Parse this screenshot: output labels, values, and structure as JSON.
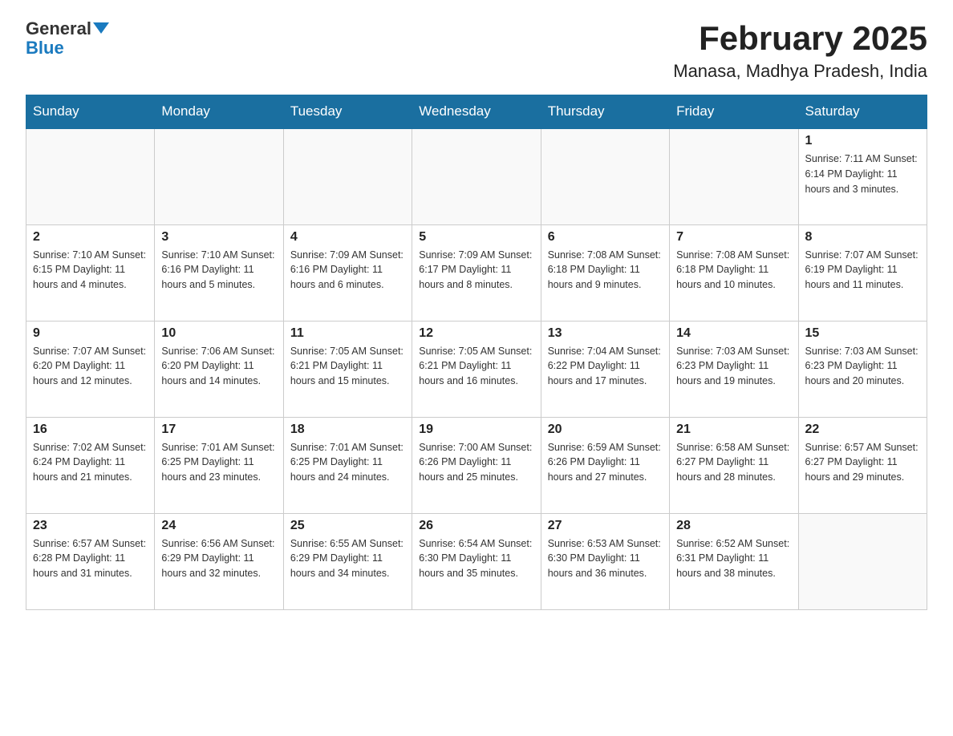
{
  "logo": {
    "general": "General",
    "blue": "Blue"
  },
  "title": "February 2025",
  "subtitle": "Manasa, Madhya Pradesh, India",
  "days_of_week": [
    "Sunday",
    "Monday",
    "Tuesday",
    "Wednesday",
    "Thursday",
    "Friday",
    "Saturday"
  ],
  "weeks": [
    [
      {
        "day": "",
        "info": ""
      },
      {
        "day": "",
        "info": ""
      },
      {
        "day": "",
        "info": ""
      },
      {
        "day": "",
        "info": ""
      },
      {
        "day": "",
        "info": ""
      },
      {
        "day": "",
        "info": ""
      },
      {
        "day": "1",
        "info": "Sunrise: 7:11 AM\nSunset: 6:14 PM\nDaylight: 11 hours and 3 minutes."
      }
    ],
    [
      {
        "day": "2",
        "info": "Sunrise: 7:10 AM\nSunset: 6:15 PM\nDaylight: 11 hours and 4 minutes."
      },
      {
        "day": "3",
        "info": "Sunrise: 7:10 AM\nSunset: 6:16 PM\nDaylight: 11 hours and 5 minutes."
      },
      {
        "day": "4",
        "info": "Sunrise: 7:09 AM\nSunset: 6:16 PM\nDaylight: 11 hours and 6 minutes."
      },
      {
        "day": "5",
        "info": "Sunrise: 7:09 AM\nSunset: 6:17 PM\nDaylight: 11 hours and 8 minutes."
      },
      {
        "day": "6",
        "info": "Sunrise: 7:08 AM\nSunset: 6:18 PM\nDaylight: 11 hours and 9 minutes."
      },
      {
        "day": "7",
        "info": "Sunrise: 7:08 AM\nSunset: 6:18 PM\nDaylight: 11 hours and 10 minutes."
      },
      {
        "day": "8",
        "info": "Sunrise: 7:07 AM\nSunset: 6:19 PM\nDaylight: 11 hours and 11 minutes."
      }
    ],
    [
      {
        "day": "9",
        "info": "Sunrise: 7:07 AM\nSunset: 6:20 PM\nDaylight: 11 hours and 12 minutes."
      },
      {
        "day": "10",
        "info": "Sunrise: 7:06 AM\nSunset: 6:20 PM\nDaylight: 11 hours and 14 minutes."
      },
      {
        "day": "11",
        "info": "Sunrise: 7:05 AM\nSunset: 6:21 PM\nDaylight: 11 hours and 15 minutes."
      },
      {
        "day": "12",
        "info": "Sunrise: 7:05 AM\nSunset: 6:21 PM\nDaylight: 11 hours and 16 minutes."
      },
      {
        "day": "13",
        "info": "Sunrise: 7:04 AM\nSunset: 6:22 PM\nDaylight: 11 hours and 17 minutes."
      },
      {
        "day": "14",
        "info": "Sunrise: 7:03 AM\nSunset: 6:23 PM\nDaylight: 11 hours and 19 minutes."
      },
      {
        "day": "15",
        "info": "Sunrise: 7:03 AM\nSunset: 6:23 PM\nDaylight: 11 hours and 20 minutes."
      }
    ],
    [
      {
        "day": "16",
        "info": "Sunrise: 7:02 AM\nSunset: 6:24 PM\nDaylight: 11 hours and 21 minutes."
      },
      {
        "day": "17",
        "info": "Sunrise: 7:01 AM\nSunset: 6:25 PM\nDaylight: 11 hours and 23 minutes."
      },
      {
        "day": "18",
        "info": "Sunrise: 7:01 AM\nSunset: 6:25 PM\nDaylight: 11 hours and 24 minutes."
      },
      {
        "day": "19",
        "info": "Sunrise: 7:00 AM\nSunset: 6:26 PM\nDaylight: 11 hours and 25 minutes."
      },
      {
        "day": "20",
        "info": "Sunrise: 6:59 AM\nSunset: 6:26 PM\nDaylight: 11 hours and 27 minutes."
      },
      {
        "day": "21",
        "info": "Sunrise: 6:58 AM\nSunset: 6:27 PM\nDaylight: 11 hours and 28 minutes."
      },
      {
        "day": "22",
        "info": "Sunrise: 6:57 AM\nSunset: 6:27 PM\nDaylight: 11 hours and 29 minutes."
      }
    ],
    [
      {
        "day": "23",
        "info": "Sunrise: 6:57 AM\nSunset: 6:28 PM\nDaylight: 11 hours and 31 minutes."
      },
      {
        "day": "24",
        "info": "Sunrise: 6:56 AM\nSunset: 6:29 PM\nDaylight: 11 hours and 32 minutes."
      },
      {
        "day": "25",
        "info": "Sunrise: 6:55 AM\nSunset: 6:29 PM\nDaylight: 11 hours and 34 minutes."
      },
      {
        "day": "26",
        "info": "Sunrise: 6:54 AM\nSunset: 6:30 PM\nDaylight: 11 hours and 35 minutes."
      },
      {
        "day": "27",
        "info": "Sunrise: 6:53 AM\nSunset: 6:30 PM\nDaylight: 11 hours and 36 minutes."
      },
      {
        "day": "28",
        "info": "Sunrise: 6:52 AM\nSunset: 6:31 PM\nDaylight: 11 hours and 38 minutes."
      },
      {
        "day": "",
        "info": ""
      }
    ]
  ]
}
